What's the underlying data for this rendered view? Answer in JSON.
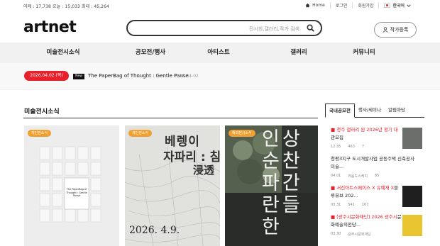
{
  "topbar": {
    "stats": "어제 : 17,738  오늘 : 15,033  최대 : 45,264",
    "home": "Home",
    "login": "로그인",
    "signup": "회원가입",
    "language": "한국어"
  },
  "header": {
    "logo": "artnet",
    "search_placeholder": "전시회,갤러리,작가 검색",
    "register_button": "작가등록"
  },
  "nav": {
    "items": [
      "미술전시소식",
      "공모전/행사",
      "아티스트",
      "갤러리",
      "커뮤니티"
    ]
  },
  "news": {
    "date_badge": "2026.04.02 (목)",
    "tag": "New",
    "title": "The PaperBag of Thought : Gentle Pause",
    "date": "2026-04-02"
  },
  "section": {
    "title": "미술전시소식"
  },
  "cards": [
    {
      "badge": "개인전소식",
      "badge_color": "#f0a030",
      "poster_title": "The PaperBag of Thought : Gentle Pause"
    },
    {
      "badge": "개인전소식",
      "badge_color": "#f0a030",
      "poster_line1": "베렝이",
      "poster_line2": "자파리 : 침투",
      "poster_line3": "浸透",
      "poster_date": "2026. 4.9."
    },
    {
      "badge": "해외전시소식",
      "badge_color": "#f0a030",
      "poster_chars": "인상순찬파간란들한"
    }
  ],
  "sidebar": {
    "tabs": [
      "국내공모전",
      "행사/세미나",
      "알림마당"
    ],
    "items": [
      {
        "prefix": "■ 청주 갤러리 원 2026년 정기 대",
        "rest": "관모집",
        "date": "12.35",
        "views": "463",
        "comments": "7"
      },
      {
        "prefix": "",
        "rest": "청평3지구 도시개발사업 공동주택 신축공사 미술...",
        "date": "04.01",
        "views": "라움드스케치",
        "comments": "85"
      },
      {
        "prefix": "■ 서진아트스페이스 X 유예재 X",
        "rest": "블루뮤브 202...",
        "date": "03.31",
        "views": "541",
        "comments": "107"
      },
      {
        "prefix": "■ [광주시문화재단] 2026 광주시",
        "rest": "문화예술의전당...",
        "date": "03.30",
        "views": "광주시문화재단",
        "comments": ""
      }
    ]
  }
}
